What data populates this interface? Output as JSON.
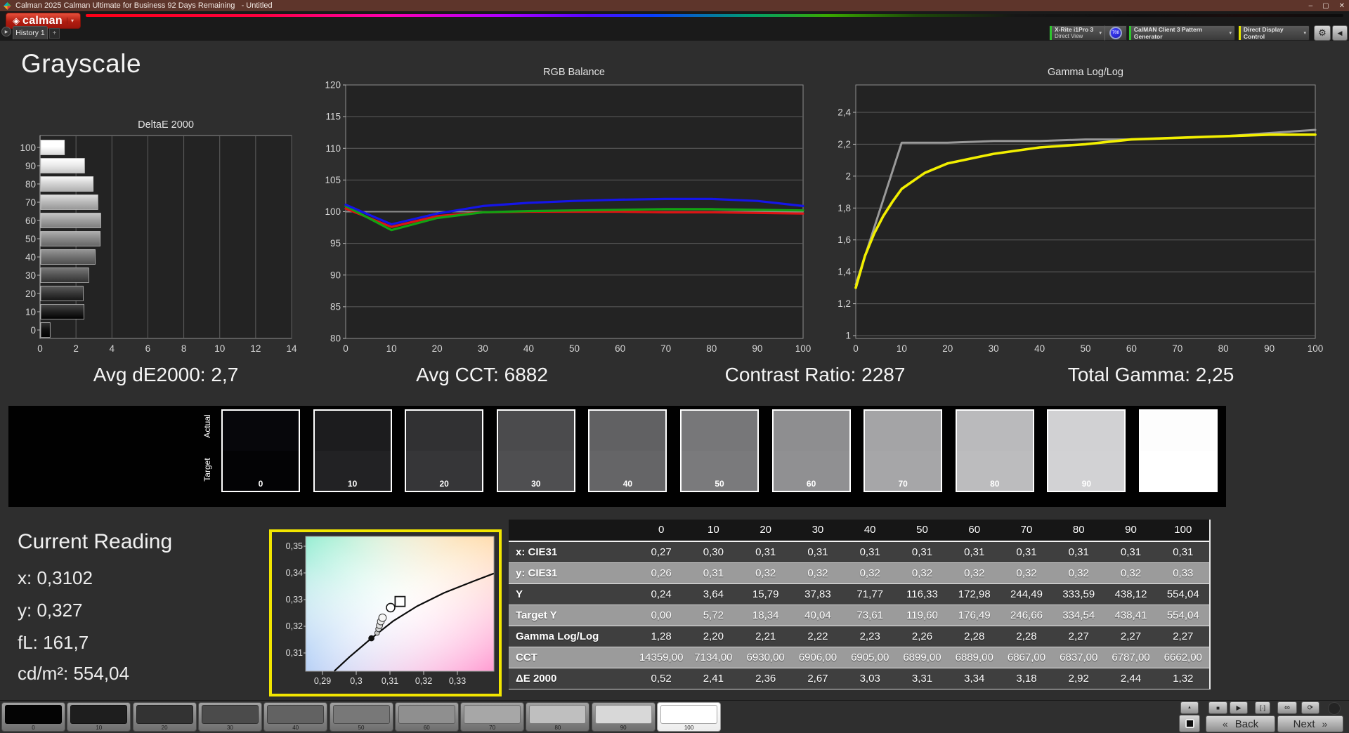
{
  "window": {
    "title": "Calman 2025 Calman Ultimate for Business 92 Days Remaining   - Untitled"
  },
  "icons": {
    "dropdown": "▾",
    "play_small": "▶",
    "plus": "+",
    "gear": "⚙",
    "back_arrow": "◀",
    "min": "–",
    "max": "▢",
    "close": "✕",
    "double_left": "«",
    "double_right": "»",
    "up": "▲",
    "stop": "■",
    "play": "▶",
    "interval": "[·]",
    "infinity": "∞",
    "loop": "⟳",
    "diamond": "◈"
  },
  "header": {
    "logo_text": "calman",
    "tab_label": "History 1"
  },
  "meters": {
    "device_line1": "X-Rite i1Pro 3",
    "device_line2": "Direct View",
    "device_badge": "708",
    "pattern_source": "CalMAN Client 3 Pattern Generator",
    "display_control": "Direct Display Control",
    "device_accent": "#2ec72e",
    "pattern_accent": "#2ec72e",
    "display_accent": "#e6e600"
  },
  "page_title": "Grayscale",
  "stats": {
    "avg_de": "Avg dE2000: 2,7",
    "avg_cct": "Avg CCT: 6882",
    "contrast": "Contrast Ratio: 2287",
    "total_gamma": "Total Gamma: 2,25"
  },
  "swatch_strip": {
    "top_label": "Actual",
    "bottom_label": "Target",
    "levels": [
      {
        "label": "0",
        "actual": "#07070b",
        "target": "#030305"
      },
      {
        "label": "10",
        "actual": "#1c1c1e",
        "target": "#222224"
      },
      {
        "label": "20",
        "actual": "#313133",
        "target": "#363638"
      },
      {
        "label": "30",
        "actual": "#4b4b4d",
        "target": "#4f4f51"
      },
      {
        "label": "40",
        "actual": "#616163",
        "target": "#656567"
      },
      {
        "label": "50",
        "actual": "#777779",
        "target": "#7a7a7c"
      },
      {
        "label": "60",
        "actual": "#8e8e90",
        "target": "#909092"
      },
      {
        "label": "70",
        "actual": "#a4a4a6",
        "target": "#a6a6a8"
      },
      {
        "label": "80",
        "actual": "#bababc",
        "target": "#bcbcbe"
      },
      {
        "label": "90",
        "actual": "#d1d1d3",
        "target": "#d2d2d4"
      },
      {
        "label": "100",
        "actual": "#fdfdfd",
        "target": "#ffffff"
      }
    ]
  },
  "current_reading": {
    "title": "Current Reading",
    "x": "x: 0,3102",
    "y": "y: 0,327",
    "fl": "fL: 161,7",
    "cdm2": "cd/m²: 554,04"
  },
  "table": {
    "columns": [
      "0",
      "10",
      "20",
      "30",
      "40",
      "50",
      "60",
      "70",
      "80",
      "90",
      "100"
    ],
    "rows": [
      {
        "label": "x: CIE31",
        "shade": "dark",
        "values": [
          "0,27",
          "0,30",
          "0,31",
          "0,31",
          "0,31",
          "0,31",
          "0,31",
          "0,31",
          "0,31",
          "0,31",
          "0,31"
        ]
      },
      {
        "label": "y: CIE31",
        "shade": "light",
        "values": [
          "0,26",
          "0,31",
          "0,32",
          "0,32",
          "0,32",
          "0,32",
          "0,32",
          "0,32",
          "0,32",
          "0,32",
          "0,33"
        ]
      },
      {
        "label": "Y",
        "shade": "dark",
        "values": [
          "0,24",
          "3,64",
          "15,79",
          "37,83",
          "71,77",
          "116,33",
          "172,98",
          "244,49",
          "333,59",
          "438,12",
          "554,04"
        ]
      },
      {
        "label": "Target Y",
        "shade": "light",
        "values": [
          "0,00",
          "5,72",
          "18,34",
          "40,04",
          "73,61",
          "119,60",
          "176,49",
          "246,66",
          "334,54",
          "438,41",
          "554,04"
        ]
      },
      {
        "label": "Gamma Log/Log",
        "shade": "dark",
        "values": [
          "1,28",
          "2,20",
          "2,21",
          "2,22",
          "2,23",
          "2,26",
          "2,28",
          "2,28",
          "2,27",
          "2,27",
          "2,27"
        ]
      },
      {
        "label": "CCT",
        "shade": "light",
        "values": [
          "14359,00",
          "7134,00",
          "6930,00",
          "6906,00",
          "6905,00",
          "6899,00",
          "6889,00",
          "6867,00",
          "6837,00",
          "6787,00",
          "6662,00"
        ]
      },
      {
        "label": "ΔE 2000",
        "shade": "dark",
        "values": [
          "0,52",
          "2,41",
          "2,36",
          "2,67",
          "3,03",
          "3,31",
          "3,34",
          "3,18",
          "2,92",
          "2,44",
          "1,32"
        ]
      }
    ]
  },
  "bottom_bar": {
    "back": "Back",
    "next": "Next",
    "patches": [
      {
        "label": "0",
        "color": "#040404",
        "selected": false
      },
      {
        "label": "10",
        "color": "#1e1e1e",
        "selected": false
      },
      {
        "label": "20",
        "color": "#333333",
        "selected": false
      },
      {
        "label": "30",
        "color": "#4b4b4b",
        "selected": false
      },
      {
        "label": "40",
        "color": "#626262",
        "selected": false
      },
      {
        "label": "50",
        "color": "#787878",
        "selected": false
      },
      {
        "label": "60",
        "color": "#8f8f8f",
        "selected": false
      },
      {
        "label": "70",
        "color": "#a7a7a7",
        "selected": false
      },
      {
        "label": "80",
        "color": "#bfbfbf",
        "selected": false
      },
      {
        "label": "90",
        "color": "#d8d8d8",
        "selected": false
      },
      {
        "label": "100",
        "color": "#ffffff",
        "selected": true
      }
    ]
  },
  "chart_data": [
    {
      "type": "bar",
      "title": "DeltaE 2000",
      "orientation": "horizontal",
      "categories": [
        100,
        90,
        80,
        70,
        60,
        50,
        40,
        30,
        20,
        10,
        0
      ],
      "values": [
        1.32,
        2.44,
        2.92,
        3.18,
        3.34,
        3.31,
        3.03,
        2.67,
        2.36,
        2.41,
        0.52
      ],
      "bar_colors": [
        "#ffffff",
        "#ececec",
        "#d5d5d5",
        "#bcbcbc",
        "#a2a2a2",
        "#8c8c8c",
        "#747474",
        "#565656",
        "#3a3a3a",
        "#242424",
        "#111111"
      ],
      "xticks": [
        0,
        2,
        4,
        6,
        8,
        10,
        12,
        14
      ],
      "xlim": [
        0,
        14
      ]
    },
    {
      "type": "line",
      "title": "RGB Balance",
      "x": [
        0,
        10,
        20,
        30,
        40,
        50,
        60,
        70,
        80,
        90,
        100
      ],
      "ylim": [
        80,
        120
      ],
      "yticks": [
        120,
        115,
        110,
        105,
        100,
        95,
        90,
        85,
        80
      ],
      "xticks": [
        0,
        10,
        20,
        30,
        40,
        50,
        60,
        70,
        80,
        90,
        100
      ],
      "series": [
        {
          "name": "Reference",
          "color": "#8f8f8f",
          "width": 2,
          "values": [
            100,
            100,
            100,
            100,
            100,
            100,
            100,
            100,
            100,
            100,
            100
          ]
        },
        {
          "name": "Red",
          "color": "#dd1414",
          "width": 3.2,
          "values": [
            100.5,
            97.6,
            99.3,
            99.9,
            100,
            100,
            100,
            99.9,
            99.9,
            99.8,
            99.7
          ]
        },
        {
          "name": "Green",
          "color": "#12a312",
          "width": 3.2,
          "values": [
            100.9,
            97.1,
            99,
            99.9,
            100.1,
            100.2,
            100.3,
            100.4,
            100.4,
            100.3,
            100.2
          ]
        },
        {
          "name": "Blue",
          "color": "#1515e8",
          "width": 3.2,
          "values": [
            101.1,
            98,
            99.7,
            100.9,
            101.4,
            101.7,
            101.9,
            102,
            102,
            101.7,
            100.9
          ]
        }
      ]
    },
    {
      "type": "line",
      "title": "Gamma Log/Log",
      "ylim": [
        1,
        2.57
      ],
      "yticks": [
        2.4,
        2.2,
        2,
        1.8,
        1.6,
        1.4,
        1.2,
        1
      ],
      "ytick_labels": [
        "2,4",
        "2,2",
        "2",
        "1,8",
        "1,6",
        "1,4",
        "1,2",
        "1"
      ],
      "xticks": [
        0,
        10,
        20,
        30,
        40,
        50,
        60,
        70,
        80,
        90,
        100
      ],
      "series": [
        {
          "name": "Target",
          "color": "#9a9a9a",
          "width": 3,
          "x": [
            0,
            10,
            20,
            30,
            40,
            50,
            60,
            70,
            80,
            90,
            100
          ],
          "values": [
            1.32,
            2.21,
            2.21,
            2.22,
            2.22,
            2.23,
            2.23,
            2.24,
            2.25,
            2.27,
            2.29
          ]
        },
        {
          "name": "Measured",
          "color": "#f2ef00",
          "width": 3.6,
          "x": [
            0,
            2,
            4,
            6,
            8,
            10,
            15,
            20,
            25,
            30,
            40,
            50,
            60,
            70,
            80,
            90,
            100
          ],
          "values": [
            1.3,
            1.5,
            1.64,
            1.75,
            1.84,
            1.92,
            2.02,
            2.08,
            2.11,
            2.14,
            2.18,
            2.2,
            2.23,
            2.24,
            2.25,
            2.26,
            2.26
          ]
        }
      ]
    },
    {
      "type": "scatter",
      "title": "CIE chromaticity detail",
      "xtick_labels": [
        "0,29",
        "0,3",
        "0,31",
        "0,32",
        "0,33"
      ],
      "ytick_labels": [
        "0,35",
        "0,34",
        "0,33",
        "0,32",
        "0,31"
      ],
      "locus": [
        [
          0.2935,
          0.3032
        ],
        [
          0.298,
          0.3085
        ],
        [
          0.3045,
          0.3155
        ],
        [
          0.311,
          0.322
        ],
        [
          0.318,
          0.3275
        ],
        [
          0.326,
          0.3325
        ],
        [
          0.335,
          0.337
        ],
        [
          0.3408,
          0.3398
        ]
      ],
      "trail": [
        [
          0.3062,
          0.3175
        ],
        [
          0.3066,
          0.319
        ],
        [
          0.3069,
          0.3203
        ],
        [
          0.3073,
          0.3218
        ],
        [
          0.3078,
          0.3232
        ]
      ],
      "reference_point": [
        0.3045,
        0.3155
      ],
      "current_point": [
        0.3102,
        0.327
      ],
      "target_point": [
        0.313,
        0.3293
      ]
    }
  ]
}
